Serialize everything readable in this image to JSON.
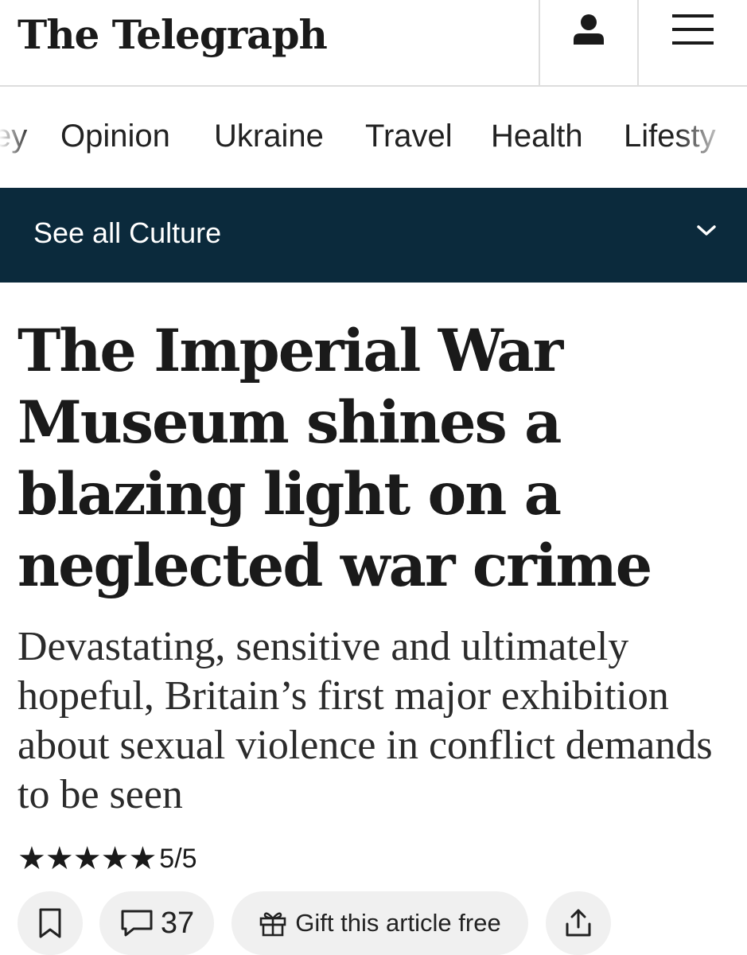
{
  "header": {
    "logo": "The Telegraph",
    "account_icon": "person-icon",
    "menu_icon": "hamburger-menu-icon"
  },
  "nav": {
    "items": [
      {
        "label": "ey"
      },
      {
        "label": "Opinion"
      },
      {
        "label": "Ukraine"
      },
      {
        "label": "Travel"
      },
      {
        "label": "Health"
      },
      {
        "label": "Lifesty"
      }
    ]
  },
  "section": {
    "label": "See all Culture",
    "icon": "chevron-down-icon",
    "background": "#0b2a3c"
  },
  "article": {
    "headline": "The Imperial War Museum shines a blazing light on a neglected war crime",
    "standfirst": "Devastating, sensitive and ultimately hopeful, Britain’s first major exhibition about sexual violence in conflict demands to be seen",
    "rating": {
      "stars": 5,
      "max": 5,
      "text": "5/5"
    }
  },
  "actions": {
    "bookmark_icon": "bookmark-icon",
    "comment_icon": "comment-icon",
    "comment_count": "37",
    "gift_icon": "gift-icon",
    "gift_label": "Gift this article free",
    "share_icon": "share-icon",
    "pill_background": "#f0f0f0"
  }
}
